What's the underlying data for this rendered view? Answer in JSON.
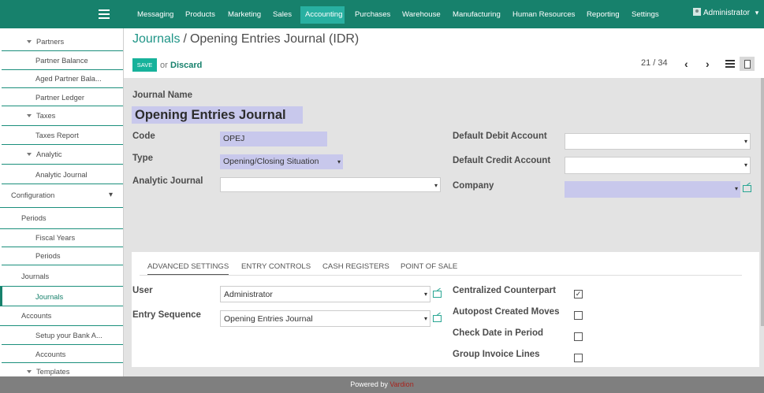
{
  "topbar": {
    "menu": [
      {
        "label": "Messaging",
        "active": false
      },
      {
        "label": "Products",
        "active": false
      },
      {
        "label": "Marketing",
        "active": false
      },
      {
        "label": "Sales",
        "active": false
      },
      {
        "label": "Accounting",
        "active": true
      },
      {
        "label": "Purchases",
        "active": false
      },
      {
        "label": "Warehouse",
        "active": false
      },
      {
        "label": "Manufacturing",
        "active": false
      },
      {
        "label": "Human Resources",
        "active": false
      },
      {
        "label": "Reporting",
        "active": false
      },
      {
        "label": "Settings",
        "active": false
      }
    ],
    "user": "Administrator",
    "user_caret": "▾"
  },
  "sidebar": {
    "items": [
      {
        "label": "Partners",
        "caret": true
      },
      {
        "label": "Partner Balance"
      },
      {
        "label": "Aged Partner Bala..."
      },
      {
        "label": "Partner Ledger"
      },
      {
        "label": "Taxes",
        "caret": true
      },
      {
        "label": "Taxes Report"
      },
      {
        "label": "Analytic",
        "caret": true
      },
      {
        "label": "Analytic Journal"
      },
      {
        "label": "Configuration",
        "dropdown": "▾"
      },
      {
        "label": "Periods"
      },
      {
        "label": "Fiscal Years"
      },
      {
        "label": "Periods"
      },
      {
        "label": "Journals"
      },
      {
        "label": "Journals",
        "active": true
      },
      {
        "label": "Accounts"
      },
      {
        "label": "Setup your Bank A..."
      },
      {
        "label": "Accounts"
      },
      {
        "label": "Templates",
        "caret": true
      }
    ]
  },
  "breadcrumb": {
    "link": "Journals",
    "separator": "/",
    "current": "Opening Entries Journal (IDR)"
  },
  "actions": {
    "save": "SAVE",
    "or": "or",
    "discard": "Discard"
  },
  "pager": {
    "value": "21 / 34",
    "prev": "‹",
    "next": "›"
  },
  "form": {
    "journal_name_label": "Journal Name",
    "journal_name": "Opening Entries Journal",
    "code_label": "Code",
    "code": "OPEJ",
    "type_label": "Type",
    "type": "Opening/Closing Situation",
    "analytic_journal_label": "Analytic Journal",
    "analytic_journal": "",
    "default_debit_label": "Default Debit Account",
    "default_debit": "",
    "default_credit_label": "Default Credit Account",
    "default_credit": "",
    "company_label": "Company",
    "company": "",
    "arrow": "▾"
  },
  "notebook": {
    "tabs": [
      {
        "label": "ADVANCED SETTINGS",
        "active": true
      },
      {
        "label": "ENTRY CONTROLS",
        "active": false
      },
      {
        "label": "CASH REGISTERS",
        "active": false
      },
      {
        "label": "POINT OF SALE",
        "active": false
      }
    ],
    "user_label": "User",
    "user": "Administrator",
    "entry_sequence_label": "Entry Sequence",
    "entry_sequence": "Opening Entries Journal",
    "centralized_label": "Centralized Counterpart",
    "centralized": true,
    "autopost_label": "Autopost Created Moves",
    "autopost": false,
    "check_date_label": "Check Date in Period",
    "check_date": false,
    "group_invoice_label": "Group Invoice Lines",
    "group_invoice": false,
    "check_mark": "✓"
  },
  "footer": {
    "text": "Powered by",
    "brand": "Vardion"
  },
  "colors": {
    "topbar": "#17816c",
    "active_menu": "#28b0a1",
    "required_field": "#c8c8ec",
    "save_button": "#17b29b",
    "footer_brand": "#a8241e"
  }
}
